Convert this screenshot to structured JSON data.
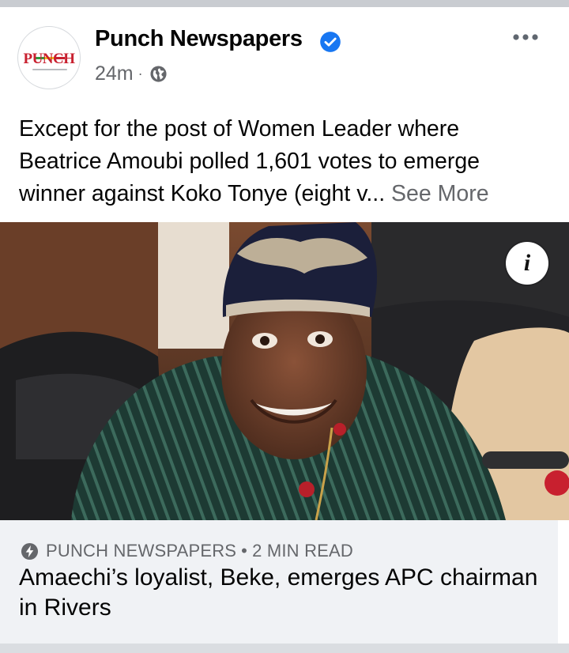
{
  "post": {
    "page_name": "Punch Newspapers",
    "verified": true,
    "time": "24m",
    "separator": "·",
    "privacy_icon": "globe-icon",
    "avatar_text": "PUNCH",
    "avatar_stripe_colors": [
      "#2e9b3e",
      "#f2c21b",
      "#c8202f"
    ],
    "text_lines": [
      "Except for the post of Women Leader where",
      "Beatrice Amoubi polled 1,601 votes to emerge",
      "winner against Koko Tonye (eight v..."
    ],
    "see_more": "See More",
    "more_icon": "more-options-icon"
  },
  "photo": {
    "info_label": "i"
  },
  "link": {
    "icon": "lightning-bolt-icon",
    "source": "PUNCH NEWSPAPERS",
    "separator": "•",
    "read_time": "2 MIN READ",
    "title": "Amaechi’s loyalist, Beke, emerges APC chairman in Rivers"
  },
  "colors": {
    "text_primary": "#050505",
    "text_secondary": "#65676b",
    "verified_blue": "#1877f2",
    "link_bg": "#f0f2f5",
    "punch_red": "#c8202f"
  }
}
